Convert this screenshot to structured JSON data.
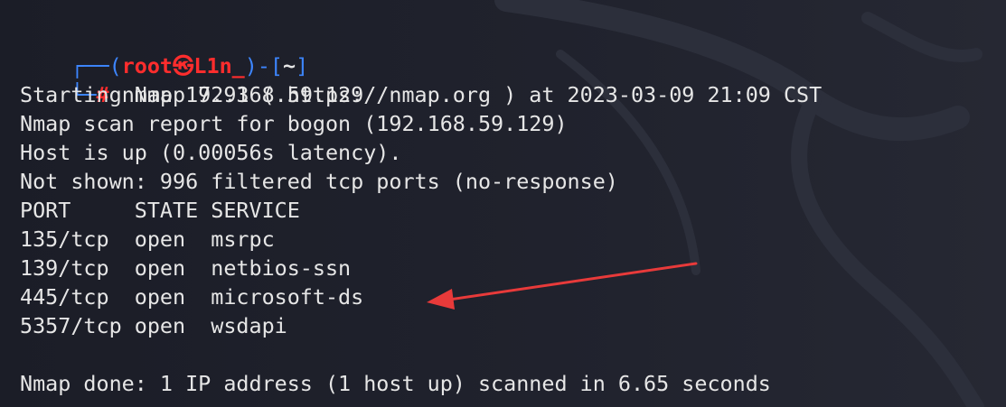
{
  "prompt": {
    "corner_top": "┌──(",
    "user": "root",
    "at_symbol": "㉿",
    "host": "L1n_",
    "dir_open": ")-[",
    "cwd": "~",
    "dir_close": "]",
    "corner_bottom": "└─",
    "hash": "#",
    "command": " nmap 192.168.59.129"
  },
  "output": [
    "Starting Nmap 7.93 ( https://nmap.org ) at 2023-03-09 21:09 CST",
    "Nmap scan report for bogon (192.168.59.129)",
    "Host is up (0.00056s latency).",
    "Not shown: 996 filtered tcp ports (no-response)",
    "PORT     STATE SERVICE",
    "135/tcp  open  msrpc",
    "139/tcp  open  netbios-ssn",
    "445/tcp  open  microsoft-ds",
    "5357/tcp open  wsdapi",
    "",
    "Nmap done: 1 IP address (1 host up) scanned in 6.65 seconds"
  ],
  "colors": {
    "background": "#1c1e29",
    "prompt_blue": "#3d86ff",
    "prompt_red": "#ff2d2d",
    "text": "#e6e6e6",
    "annotation_arrow": "#e83a3a"
  },
  "annotation": {
    "type": "arrow",
    "points_to_line": 7
  }
}
